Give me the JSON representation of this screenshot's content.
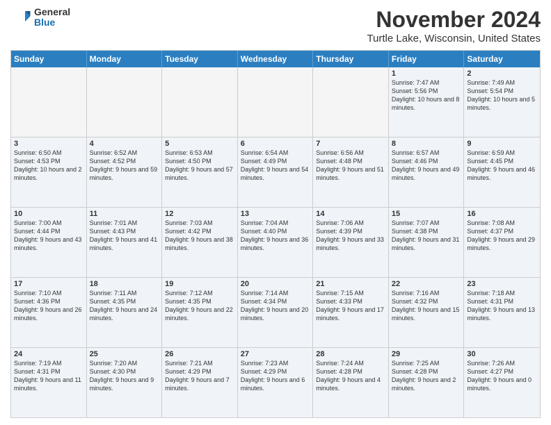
{
  "logo": {
    "general": "General",
    "blue": "Blue"
  },
  "header": {
    "month": "November 2024",
    "location": "Turtle Lake, Wisconsin, United States"
  },
  "days": [
    "Sunday",
    "Monday",
    "Tuesday",
    "Wednesday",
    "Thursday",
    "Friday",
    "Saturday"
  ],
  "rows": [
    [
      {
        "day": "",
        "info": ""
      },
      {
        "day": "",
        "info": ""
      },
      {
        "day": "",
        "info": ""
      },
      {
        "day": "",
        "info": ""
      },
      {
        "day": "",
        "info": ""
      },
      {
        "day": "1",
        "info": "Sunrise: 7:47 AM\nSunset: 5:56 PM\nDaylight: 10 hours and 8 minutes."
      },
      {
        "day": "2",
        "info": "Sunrise: 7:49 AM\nSunset: 5:54 PM\nDaylight: 10 hours and 5 minutes."
      }
    ],
    [
      {
        "day": "3",
        "info": "Sunrise: 6:50 AM\nSunset: 4:53 PM\nDaylight: 10 hours and 2 minutes."
      },
      {
        "day": "4",
        "info": "Sunrise: 6:52 AM\nSunset: 4:52 PM\nDaylight: 9 hours and 59 minutes."
      },
      {
        "day": "5",
        "info": "Sunrise: 6:53 AM\nSunset: 4:50 PM\nDaylight: 9 hours and 57 minutes."
      },
      {
        "day": "6",
        "info": "Sunrise: 6:54 AM\nSunset: 4:49 PM\nDaylight: 9 hours and 54 minutes."
      },
      {
        "day": "7",
        "info": "Sunrise: 6:56 AM\nSunset: 4:48 PM\nDaylight: 9 hours and 51 minutes."
      },
      {
        "day": "8",
        "info": "Sunrise: 6:57 AM\nSunset: 4:46 PM\nDaylight: 9 hours and 49 minutes."
      },
      {
        "day": "9",
        "info": "Sunrise: 6:59 AM\nSunset: 4:45 PM\nDaylight: 9 hours and 46 minutes."
      }
    ],
    [
      {
        "day": "10",
        "info": "Sunrise: 7:00 AM\nSunset: 4:44 PM\nDaylight: 9 hours and 43 minutes."
      },
      {
        "day": "11",
        "info": "Sunrise: 7:01 AM\nSunset: 4:43 PM\nDaylight: 9 hours and 41 minutes."
      },
      {
        "day": "12",
        "info": "Sunrise: 7:03 AM\nSunset: 4:42 PM\nDaylight: 9 hours and 38 minutes."
      },
      {
        "day": "13",
        "info": "Sunrise: 7:04 AM\nSunset: 4:40 PM\nDaylight: 9 hours and 36 minutes."
      },
      {
        "day": "14",
        "info": "Sunrise: 7:06 AM\nSunset: 4:39 PM\nDaylight: 9 hours and 33 minutes."
      },
      {
        "day": "15",
        "info": "Sunrise: 7:07 AM\nSunset: 4:38 PM\nDaylight: 9 hours and 31 minutes."
      },
      {
        "day": "16",
        "info": "Sunrise: 7:08 AM\nSunset: 4:37 PM\nDaylight: 9 hours and 29 minutes."
      }
    ],
    [
      {
        "day": "17",
        "info": "Sunrise: 7:10 AM\nSunset: 4:36 PM\nDaylight: 9 hours and 26 minutes."
      },
      {
        "day": "18",
        "info": "Sunrise: 7:11 AM\nSunset: 4:35 PM\nDaylight: 9 hours and 24 minutes."
      },
      {
        "day": "19",
        "info": "Sunrise: 7:12 AM\nSunset: 4:35 PM\nDaylight: 9 hours and 22 minutes."
      },
      {
        "day": "20",
        "info": "Sunrise: 7:14 AM\nSunset: 4:34 PM\nDaylight: 9 hours and 20 minutes."
      },
      {
        "day": "21",
        "info": "Sunrise: 7:15 AM\nSunset: 4:33 PM\nDaylight: 9 hours and 17 minutes."
      },
      {
        "day": "22",
        "info": "Sunrise: 7:16 AM\nSunset: 4:32 PM\nDaylight: 9 hours and 15 minutes."
      },
      {
        "day": "23",
        "info": "Sunrise: 7:18 AM\nSunset: 4:31 PM\nDaylight: 9 hours and 13 minutes."
      }
    ],
    [
      {
        "day": "24",
        "info": "Sunrise: 7:19 AM\nSunset: 4:31 PM\nDaylight: 9 hours and 11 minutes."
      },
      {
        "day": "25",
        "info": "Sunrise: 7:20 AM\nSunset: 4:30 PM\nDaylight: 9 hours and 9 minutes."
      },
      {
        "day": "26",
        "info": "Sunrise: 7:21 AM\nSunset: 4:29 PM\nDaylight: 9 hours and 7 minutes."
      },
      {
        "day": "27",
        "info": "Sunrise: 7:23 AM\nSunset: 4:29 PM\nDaylight: 9 hours and 6 minutes."
      },
      {
        "day": "28",
        "info": "Sunrise: 7:24 AM\nSunset: 4:28 PM\nDaylight: 9 hours and 4 minutes."
      },
      {
        "day": "29",
        "info": "Sunrise: 7:25 AM\nSunset: 4:28 PM\nDaylight: 9 hours and 2 minutes."
      },
      {
        "day": "30",
        "info": "Sunrise: 7:26 AM\nSunset: 4:27 PM\nDaylight: 9 hours and 0 minutes."
      }
    ]
  ]
}
